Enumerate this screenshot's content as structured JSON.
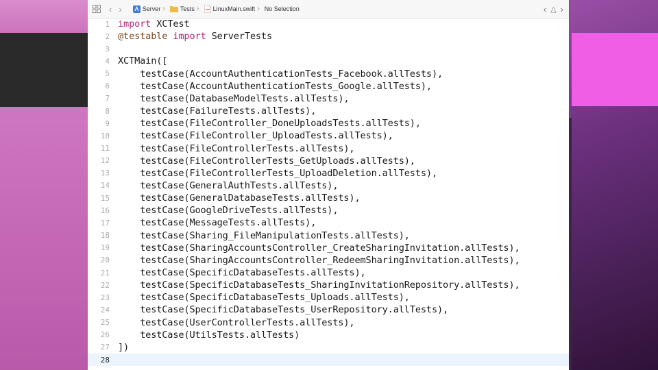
{
  "jumpbar": {
    "crumbs": [
      "Server",
      "Tests",
      "LinuxMain.swift",
      "No Selection"
    ]
  },
  "colors": {
    "keyword": "#b6247a",
    "attribute": "#7a4a1d",
    "current_line": "#ecf5ff",
    "accent_right": "#f15ee6"
  },
  "code": {
    "current_line": 28,
    "lines": [
      {
        "n": "1",
        "kw": "import",
        "rest": " XCTest"
      },
      {
        "n": "2",
        "attr": "@testable",
        "kw": "import",
        "rest": " ServerTests"
      },
      {
        "n": "3",
        "text": ""
      },
      {
        "n": "4",
        "text": "XCTMain(["
      },
      {
        "n": "5",
        "text": "    testCase(AccountAuthenticationTests_Facebook.allTests),"
      },
      {
        "n": "6",
        "text": "    testCase(AccountAuthenticationTests_Google.allTests),"
      },
      {
        "n": "7",
        "text": "    testCase(DatabaseModelTests.allTests),"
      },
      {
        "n": "8",
        "text": "    testCase(FailureTests.allTests),"
      },
      {
        "n": "9",
        "text": "    testCase(FileController_DoneUploadsTests.allTests),"
      },
      {
        "n": "10",
        "text": "    testCase(FileController_UploadTests.allTests),"
      },
      {
        "n": "11",
        "text": "    testCase(FileControllerTests.allTests),"
      },
      {
        "n": "12",
        "text": "    testCase(FileControllerTests_GetUploads.allTests),"
      },
      {
        "n": "13",
        "text": "    testCase(FileControllerTests_UploadDeletion.allTests),"
      },
      {
        "n": "14",
        "text": "    testCase(GeneralAuthTests.allTests),"
      },
      {
        "n": "15",
        "text": "    testCase(GeneralDatabaseTests.allTests),"
      },
      {
        "n": "16",
        "text": "    testCase(GoogleDriveTests.allTests),"
      },
      {
        "n": "17",
        "text": "    testCase(MessageTests.allTests),"
      },
      {
        "n": "18",
        "text": "    testCase(Sharing_FileManipulationTests.allTests),"
      },
      {
        "n": "19",
        "text": "    testCase(SharingAccountsController_CreateSharingInvitation.allTests),"
      },
      {
        "n": "20",
        "text": "    testCase(SharingAccountsController_RedeemSharingInvitation.allTests),"
      },
      {
        "n": "21",
        "text": "    testCase(SpecificDatabaseTests.allTests),"
      },
      {
        "n": "22",
        "text": "    testCase(SpecificDatabaseTests_SharingInvitationRepository.allTests),"
      },
      {
        "n": "23",
        "text": "    testCase(SpecificDatabaseTests_Uploads.allTests),"
      },
      {
        "n": "24",
        "text": "    testCase(SpecificDatabaseTests_UserRepository.allTests),"
      },
      {
        "n": "25",
        "text": "    testCase(UserControllerTests.allTests),"
      },
      {
        "n": "26",
        "text": "    testCase(UtilsTests.allTests)"
      },
      {
        "n": "27",
        "text": "])"
      },
      {
        "n": "28",
        "text": ""
      }
    ]
  }
}
